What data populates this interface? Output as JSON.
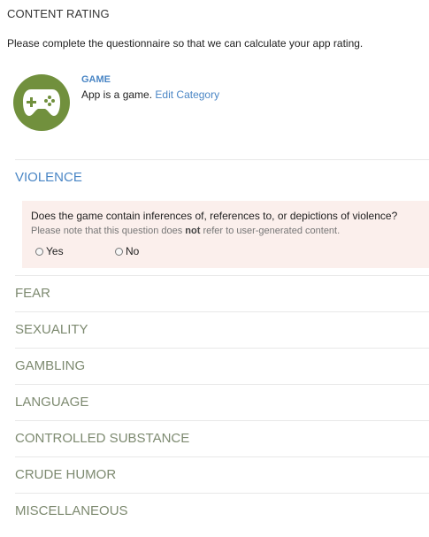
{
  "header": {
    "title": "CONTENT RATING",
    "intro": "Please complete the questionnaire so that we can calculate your app rating."
  },
  "category": {
    "icon": "gamepad-icon",
    "icon_bg": "#71903d",
    "name": "GAME",
    "description": "App is a game.",
    "edit_link": "Edit Category"
  },
  "sections": {
    "violence": {
      "label": "VIOLENCE",
      "question": "Does the game contain inferences of, references to, or depictions of violence?",
      "note_prefix": "Please note that this question does ",
      "note_emphasis": "not",
      "note_suffix": " refer to user-generated content.",
      "option_yes": "Yes",
      "option_no": "No"
    },
    "fear": {
      "label": "FEAR"
    },
    "sexuality": {
      "label": "SEXUALITY"
    },
    "gambling": {
      "label": "GAMBLING"
    },
    "language": {
      "label": "LANGUAGE"
    },
    "controlled_substance": {
      "label": "CONTROLLED SUBSTANCE"
    },
    "crude_humor": {
      "label": "CRUDE HUMOR"
    },
    "miscellaneous": {
      "label": "MISCELLANEOUS"
    }
  },
  "colors": {
    "active_section": "#4a86c5",
    "inactive_section": "#7d8a70",
    "question_bg": "#fbefec"
  }
}
